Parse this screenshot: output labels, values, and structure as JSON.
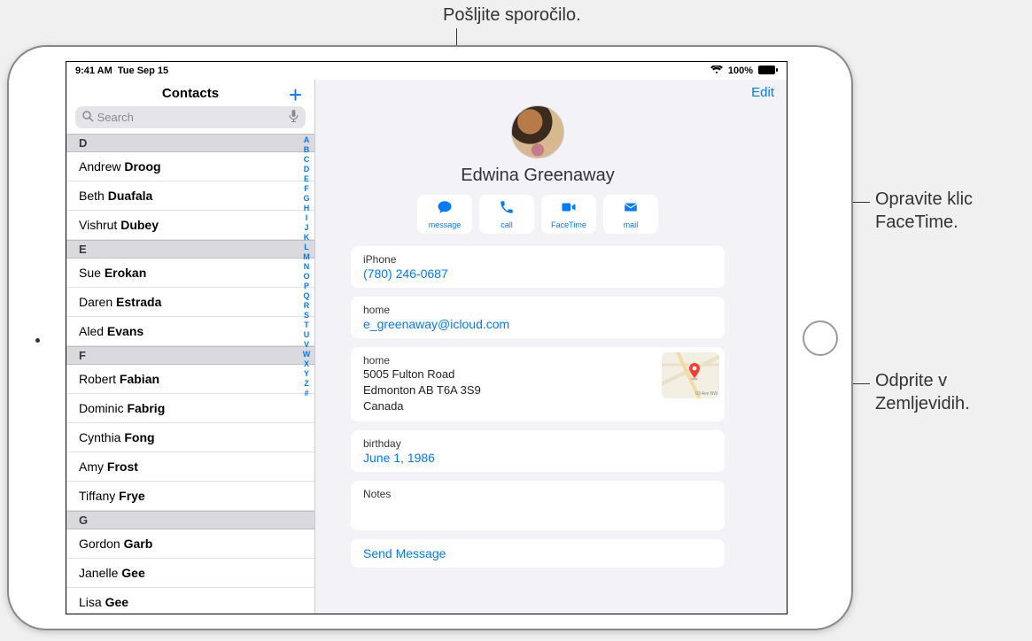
{
  "statusbar": {
    "time": "9:41 AM",
    "date": "Tue Sep 15",
    "batt": "100%"
  },
  "sidebar": {
    "title": "Contacts",
    "search_placeholder": "Search",
    "sections": [
      {
        "letter": "D",
        "rows": [
          {
            "first": "Andrew",
            "last": "Droog"
          },
          {
            "first": "Beth",
            "last": "Duafala"
          },
          {
            "first": "Vishrut",
            "last": "Dubey"
          }
        ]
      },
      {
        "letter": "E",
        "rows": [
          {
            "first": "Sue",
            "last": "Erokan"
          },
          {
            "first": "Daren",
            "last": "Estrada"
          },
          {
            "first": "Aled",
            "last": "Evans"
          }
        ]
      },
      {
        "letter": "F",
        "rows": [
          {
            "first": "Robert",
            "last": "Fabian"
          },
          {
            "first": "Dominic",
            "last": "Fabrig"
          },
          {
            "first": "Cynthia",
            "last": "Fong"
          },
          {
            "first": "Amy",
            "last": "Frost"
          },
          {
            "first": "Tiffany",
            "last": "Frye"
          }
        ]
      },
      {
        "letter": "G",
        "rows": [
          {
            "first": "Gordon",
            "last": "Garb"
          },
          {
            "first": "Janelle",
            "last": "Gee"
          },
          {
            "first": "Lisa",
            "last": "Gee"
          }
        ]
      }
    ],
    "index": [
      "A",
      "B",
      "C",
      "D",
      "E",
      "F",
      "G",
      "H",
      "I",
      "J",
      "K",
      "L",
      "M",
      "N",
      "O",
      "P",
      "Q",
      "R",
      "S",
      "T",
      "U",
      "V",
      "W",
      "X",
      "Y",
      "Z",
      "#"
    ]
  },
  "detail": {
    "edit": "Edit",
    "name": "Edwina Greenaway",
    "actions": {
      "message": "message",
      "call": "call",
      "facetime": "FaceTime",
      "mail": "mail"
    },
    "phone": {
      "label": "iPhone",
      "value": "(780) 246-0687"
    },
    "email": {
      "label": "home",
      "value": "e_greenaway@icloud.com"
    },
    "address": {
      "label": "home",
      "line1": "5005 Fulton Road",
      "line2": "Edmonton AB T6A 3S9",
      "line3": "Canada",
      "maplabel": "03 Ave NW"
    },
    "birthday": {
      "label": "birthday",
      "value": "June 1, 1986"
    },
    "notes_label": "Notes",
    "send_message": "Send Message"
  },
  "callouts": {
    "top": "Pošljite sporočilo.",
    "right1a": "Opravite klic",
    "right1b": "FaceTime.",
    "right2a": "Odprite v",
    "right2b": "Zemljevidih."
  }
}
